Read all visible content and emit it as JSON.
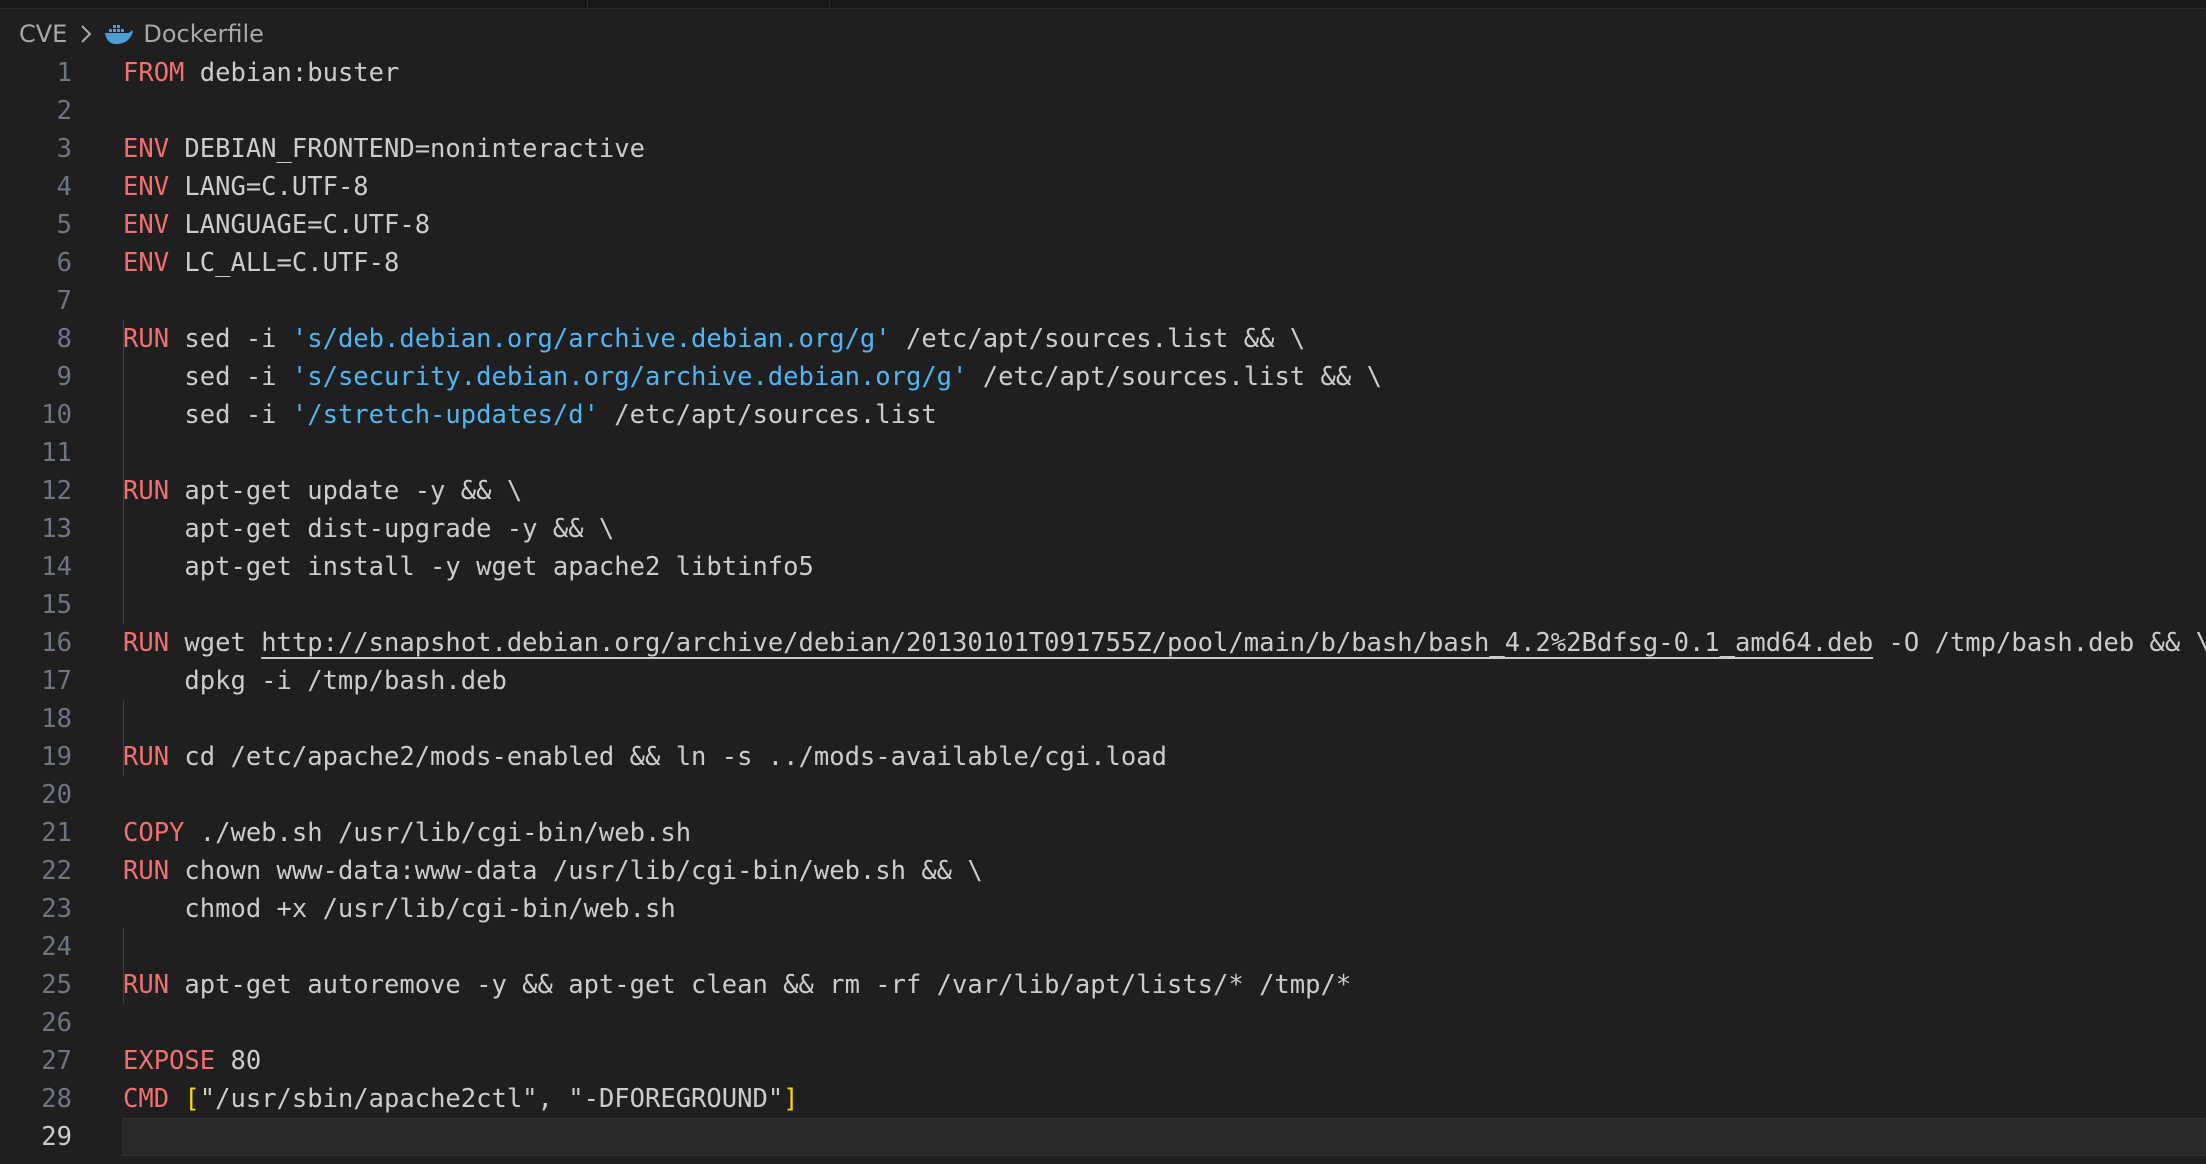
{
  "breadcrumb": {
    "folder": "CVE",
    "file": "Dockerfile",
    "file_icon": "docker-whale-icon",
    "separator_icon": "chevron-right-icon"
  },
  "colors": {
    "background": "#1f1f1f",
    "keyword": "#f2706f",
    "string": "#4fb6f5",
    "bracket": "#ffd700",
    "line_number": "#6e7681",
    "text": "#cccccc"
  },
  "editor": {
    "current_line": 29,
    "lines": [
      {
        "n": "1",
        "tokens": [
          {
            "t": "FROM",
            "c": "kw"
          },
          {
            "t": " debian:buster"
          }
        ]
      },
      {
        "n": "2",
        "tokens": []
      },
      {
        "n": "3",
        "tokens": [
          {
            "t": "ENV",
            "c": "kw"
          },
          {
            "t": " DEBIAN_FRONTEND=noninteractive"
          }
        ]
      },
      {
        "n": "4",
        "tokens": [
          {
            "t": "ENV",
            "c": "kw"
          },
          {
            "t": " LANG=C.UTF-8"
          }
        ]
      },
      {
        "n": "5",
        "tokens": [
          {
            "t": "ENV",
            "c": "kw"
          },
          {
            "t": " LANGUAGE=C.UTF-8"
          }
        ]
      },
      {
        "n": "6",
        "tokens": [
          {
            "t": "ENV",
            "c": "kw"
          },
          {
            "t": " LC_ALL=C.UTF-8"
          }
        ]
      },
      {
        "n": "7",
        "tokens": []
      },
      {
        "n": "8",
        "tokens": [
          {
            "t": "RUN",
            "c": "kw"
          },
          {
            "t": " sed -i "
          },
          {
            "t": "'s/deb.debian.org/archive.debian.org/g'",
            "c": "str"
          },
          {
            "t": " /etc/apt/sources.list && \\"
          }
        ]
      },
      {
        "n": "9",
        "tokens": [
          {
            "t": "    sed -i "
          },
          {
            "t": "'s/security.debian.org/archive.debian.org/g'",
            "c": "str"
          },
          {
            "t": " /etc/apt/sources.list && \\"
          }
        ]
      },
      {
        "n": "10",
        "tokens": [
          {
            "t": "    sed -i "
          },
          {
            "t": "'/stretch-updates/d'",
            "c": "str"
          },
          {
            "t": " /etc/apt/sources.list"
          }
        ]
      },
      {
        "n": "11",
        "tokens": []
      },
      {
        "n": "12",
        "tokens": [
          {
            "t": "RUN",
            "c": "kw"
          },
          {
            "t": " apt-get update -y && \\"
          }
        ]
      },
      {
        "n": "13",
        "tokens": [
          {
            "t": "    apt-get dist-upgrade -y && \\"
          }
        ]
      },
      {
        "n": "14",
        "tokens": [
          {
            "t": "    apt-get install -y wget apache2 libtinfo5"
          }
        ]
      },
      {
        "n": "15",
        "tokens": []
      },
      {
        "n": "16",
        "tokens": [
          {
            "t": "RUN",
            "c": "kw"
          },
          {
            "t": " wget "
          },
          {
            "t": "http://snapshot.debian.org/archive/debian/20130101T091755Z/pool/main/b/bash/bash_4.2%2Bdfsg-0.1_amd64.deb",
            "c": "link"
          },
          {
            "t": " -O /tmp/bash.deb && \\"
          }
        ]
      },
      {
        "n": "17",
        "tokens": [
          {
            "t": "    dpkg -i /tmp/bash.deb"
          }
        ]
      },
      {
        "n": "18",
        "tokens": []
      },
      {
        "n": "19",
        "tokens": [
          {
            "t": "RUN",
            "c": "kw"
          },
          {
            "t": " cd /etc/apache2/mods-enabled && ln -s ../mods-available/cgi.load"
          }
        ]
      },
      {
        "n": "20",
        "tokens": []
      },
      {
        "n": "21",
        "tokens": [
          {
            "t": "COPY",
            "c": "kw"
          },
          {
            "t": " ./web.sh /usr/lib/cgi-bin/web.sh"
          }
        ]
      },
      {
        "n": "22",
        "tokens": [
          {
            "t": "RUN",
            "c": "kw"
          },
          {
            "t": " chown www-data:www-data /usr/lib/cgi-bin/web.sh && \\"
          }
        ]
      },
      {
        "n": "23",
        "tokens": [
          {
            "t": "    chmod +x /usr/lib/cgi-bin/web.sh"
          }
        ]
      },
      {
        "n": "24",
        "tokens": []
      },
      {
        "n": "25",
        "tokens": [
          {
            "t": "RUN",
            "c": "kw"
          },
          {
            "t": " apt-get autoremove -y && apt-get clean && rm -rf /var/lib/apt/lists/* /tmp/*"
          }
        ]
      },
      {
        "n": "26",
        "tokens": []
      },
      {
        "n": "27",
        "tokens": [
          {
            "t": "EXPOSE",
            "c": "kw"
          },
          {
            "t": " 80"
          }
        ]
      },
      {
        "n": "28",
        "tokens": [
          {
            "t": "CMD",
            "c": "kw"
          },
          {
            "t": " "
          },
          {
            "t": "[",
            "c": "br"
          },
          {
            "t": "\"/usr/sbin/apache2ctl\", \"-DFOREGROUND\""
          },
          {
            "t": "]",
            "c": "br"
          }
        ]
      },
      {
        "n": "29",
        "tokens": []
      }
    ]
  }
}
